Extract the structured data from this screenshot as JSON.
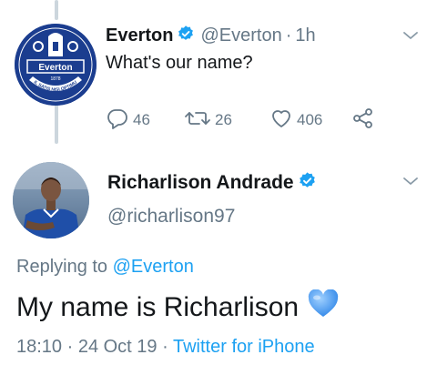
{
  "tweet1": {
    "display_name": "Everton",
    "handle": "@Everton",
    "separator": "·",
    "time": "1h",
    "text": "What's our name?",
    "avatar": {
      "crest_text": "Everton",
      "crest_year": "1878",
      "ring_text": "NIL SATIS NISI OPTIMUM"
    },
    "actions": {
      "replies": "46",
      "retweets": "26",
      "likes": "406"
    }
  },
  "tweet2": {
    "display_name": "Richarlison Andrade",
    "handle": "@richarlison97",
    "replying_prefix": "Replying to",
    "replying_to": "@Everton",
    "text": "My name is Richarlison",
    "timestamp": "18:10 · 24 Oct 19",
    "meta_separator": "·",
    "source": "Twitter for iPhone"
  },
  "colors": {
    "accent": "#1da1f2",
    "secondary_text": "#657786",
    "primary_text": "#14171a",
    "thread_line": "#ccd6dd",
    "everton_blue": "#1b3d8f",
    "heart_emoji": "#4a9cf0"
  },
  "icons": [
    "verified-badge-icon",
    "chevron-down-icon",
    "reply-icon",
    "retweet-icon",
    "like-icon",
    "share-icon",
    "blue-heart-emoji"
  ]
}
